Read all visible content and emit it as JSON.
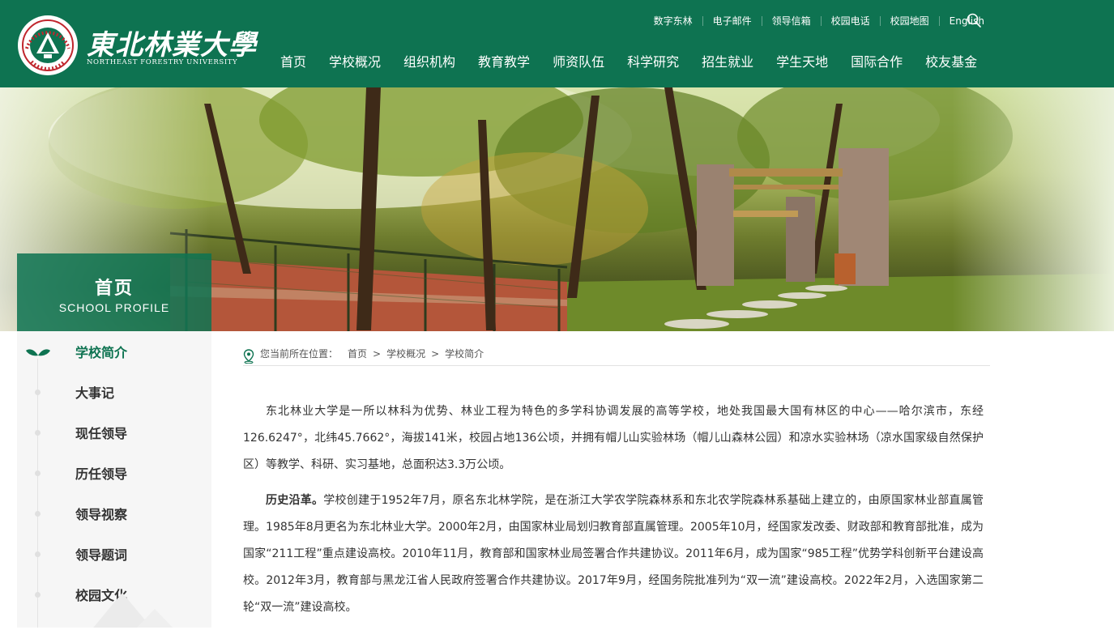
{
  "header": {
    "logo_cn": "東北林業大學",
    "logo_en": "NORTHEAST FORESTRY UNIVERSITY",
    "seal_text": "NORTHEAST FORESTRY UNIVERSITY",
    "seal_year": "1952",
    "utility_links": [
      "数字东林",
      "电子邮件",
      "领导信箱",
      "校园电话",
      "校园地图",
      "English"
    ],
    "main_nav": [
      "首页",
      "学校概况",
      "组织机构",
      "教育教学",
      "师资队伍",
      "科学研究",
      "招生就业",
      "学生天地",
      "国际合作",
      "校友基金"
    ]
  },
  "banner": {
    "title": "首页",
    "subtitle": "SCHOOL PROFILE"
  },
  "sidenav": {
    "items": [
      {
        "label": "学校简介",
        "active": true
      },
      {
        "label": "大事记",
        "active": false
      },
      {
        "label": "现任领导",
        "active": false
      },
      {
        "label": "历任领导",
        "active": false
      },
      {
        "label": "领导视察",
        "active": false
      },
      {
        "label": "领导题词",
        "active": false
      },
      {
        "label": "校园文化",
        "active": false
      }
    ]
  },
  "breadcrumb": {
    "lead": "您当前所在位置：",
    "items": [
      "首页",
      "学校概况",
      "学校简介"
    ],
    "separator": ">"
  },
  "article": {
    "p1": "东北林业大学是一所以林科为优势、林业工程为特色的多学科协调发展的高等学校，地处我国最大国有林区的中心——哈尔滨市，东经126.6247°，北纬45.7662°，海拔141米，校园占地136公顷，并拥有帽儿山实验林场（帽儿山森林公园）和凉水实验林场（凉水国家级自然保护区）等教学、科研、实习基地，总面积达3.3万公顷。",
    "p2_lead": "历史沿革。",
    "p2": "学校创建于1952年7月，原名东北林学院，是在浙江大学农学院森林系和东北农学院森林系基础上建立的，由原国家林业部直属管理。1985年8月更名为东北林业大学。2000年2月，由国家林业局划归教育部直属管理。2005年10月，经国家发改委、财政部和教育部批准，成为国家“211工程”重点建设高校。2010年11月，教育部和国家林业局签署合作共建协议。2011年6月，成为国家“985工程”优势学科创新平台建设高校。2012年3月，教育部与黑龙江省人民政府签署合作共建协议。2017年9月，经国务院批准列为“双一流”建设高校。2022年2月，入选国家第二轮“双一流”建设高校。"
  },
  "colors": {
    "brand_green": "#0e7351",
    "sidebar_bg": "#f6f6f6",
    "text": "#333333"
  }
}
